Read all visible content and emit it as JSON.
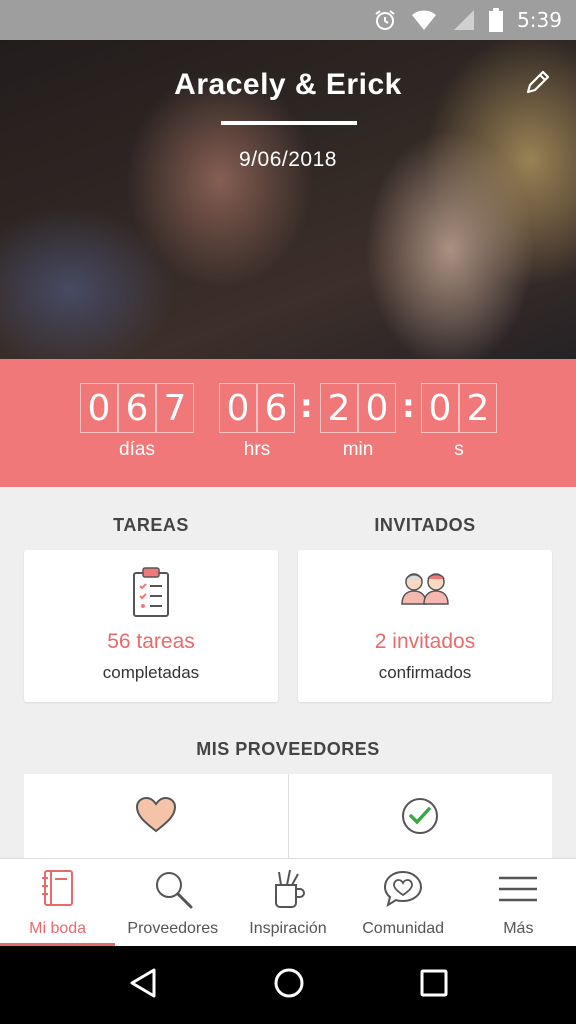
{
  "status_bar": {
    "time": "5:39"
  },
  "header": {
    "couple_name": "Aracely & Erick",
    "wedding_date": "9/06/2018"
  },
  "countdown": {
    "days": [
      "0",
      "6",
      "7"
    ],
    "hours": [
      "0",
      "6"
    ],
    "minutes": [
      "2",
      "0"
    ],
    "seconds": [
      "0",
      "2"
    ],
    "labels": {
      "days": "días",
      "hours": "hrs",
      "minutes": "min",
      "seconds": "s"
    }
  },
  "tasks": {
    "title": "TAREAS",
    "value": "56 tareas",
    "sub": "completadas",
    "icon": "clipboard-icon"
  },
  "guests": {
    "title": "INVITADOS",
    "value": "2 invitados",
    "sub": "confirmados",
    "icon": "guests-icon"
  },
  "providers": {
    "title": "MIS PROVEEDORES",
    "icons": [
      "heart-icon",
      "check-circle-icon"
    ]
  },
  "nav": {
    "items": [
      {
        "label": "Mi boda",
        "icon": "notebook-icon",
        "active": true
      },
      {
        "label": "Proveedores",
        "icon": "search-icon"
      },
      {
        "label": "Inspiración",
        "icon": "pencil-cup-icon"
      },
      {
        "label": "Comunidad",
        "icon": "chat-heart-icon"
      },
      {
        "label": "Más",
        "icon": "menu-icon"
      }
    ]
  },
  "colors": {
    "accent": "#f07878",
    "text_accent": "#e86a6a",
    "check_green": "#3aa845",
    "heart_fill": "#f5c4a8"
  }
}
